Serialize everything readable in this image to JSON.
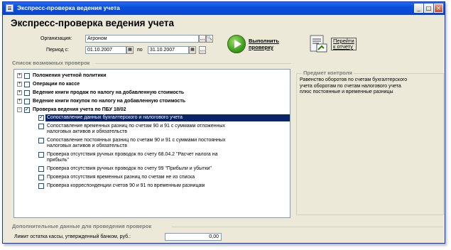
{
  "window": {
    "title": "Экспресс-проверка ведения учета",
    "min_label": "_",
    "max_label": "□",
    "close_label": "×"
  },
  "page_title": "Экспресс-проверка ведения учета",
  "organization": {
    "label": "Организация:",
    "value": "Агроном",
    "select_label": "...",
    "search_label": "🔍"
  },
  "period": {
    "label": "Период с:",
    "from": "01.10.2007",
    "to_label": "по",
    "to": "31.10.2007",
    "calendar_label": "▦",
    "more_label": "..."
  },
  "run_button": {
    "line1": "Выполнить",
    "line2": "проверку"
  },
  "report_button": {
    "line1": "Перейти",
    "line2": "к отчету"
  },
  "checks_section_title": "Список возможных проверок",
  "checks": [
    {
      "text": "Положения учетной политики",
      "bold": true,
      "expand": "+",
      "checked": false
    },
    {
      "text": "Операции по кассе",
      "bold": true,
      "expand": "+",
      "checked": false
    },
    {
      "text": "Ведение книги продаж по налогу на добавленную стоимость",
      "bold": true,
      "expand": "+",
      "checked": false
    },
    {
      "text": "Ведение книги покупок по налогу на добавленную стоимость",
      "bold": true,
      "expand": "+",
      "checked": false
    },
    {
      "text": "Проверка ведения учета по ПБУ 18/02",
      "bold": true,
      "expand": "−",
      "checked": true
    },
    {
      "lines": [
        "Сопоставление данных бухгалтерского и налогового учета"
      ],
      "checked": true,
      "selected": true
    },
    {
      "lines": [
        "Сопоставление временных разниц по счетам 90 и 91 с суммами отложенных",
        "налоговых активов и обязательств"
      ],
      "checked": false
    },
    {
      "lines": [
        "Сопоставление постоянных разниц по счетам 90 и 91 с суммами постоянных",
        "налоговых активов и обязательств"
      ],
      "checked": false
    },
    {
      "lines": [
        "Проверка отсутствия ручных проводок по счету 68.04.2 \"Расчет налога на",
        "прибыль\""
      ],
      "checked": false
    },
    {
      "lines": [
        "Проверка отсутствия ручных проводок по счету 99 \"Прибыли и убытки\""
      ],
      "checked": false
    },
    {
      "lines": [
        "Проверка отсутствия временных разниц по счетам не из списка"
      ],
      "checked": false
    },
    {
      "lines": [
        "Проверка корреспонденции счетов 90 и 91 по временным разницам"
      ],
      "checked": false
    }
  ],
  "subject": {
    "title": "Предмет контроля",
    "lines": [
      "Равенство оборотов по счетам бухгалтерского",
      "учета оборотам по счетам налогового учета",
      "плюс постоянные и временные разницы"
    ]
  },
  "additional": {
    "title": "Дополнительные данные для проведения проверок",
    "limit_label": "Лимит остатка кассы, утвержденный банком, руб.:",
    "limit_value": "0,00"
  }
}
